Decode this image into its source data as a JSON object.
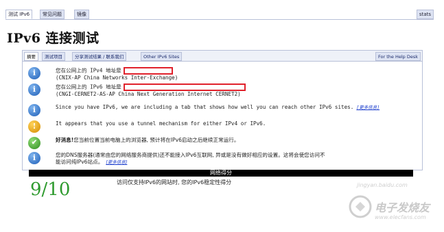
{
  "top_tabs": [
    {
      "label": "测试 IPv6",
      "active": true
    },
    {
      "label": "常见问题",
      "active": false
    },
    {
      "label": "镜像",
      "active": false
    }
  ],
  "top_right_tab": "stats",
  "page_title": "IPv6  连接测试",
  "sub_tabs": [
    {
      "label": "摘要",
      "active": true
    },
    {
      "label": "测试项目",
      "active": false
    },
    {
      "label": "分享测试结果 / 联系我们",
      "active": false
    },
    {
      "label": "Other IPv6 Sites",
      "active": false
    }
  ],
  "help_tab": "For the Help Desk",
  "rows": [
    {
      "icon": "info",
      "line1": "您在公网上的 IPv4 地址是",
      "line2": "(CNIX-AP China Networks Inter-Exchange)"
    },
    {
      "icon": "info",
      "line1": "您在公网上的 IPv6 地址是",
      "line2": "(CNGI-CERNET2-AS-AP China Next Generation Internet CERNET2)"
    },
    {
      "icon": "info",
      "line1": "Since you have IPv6, we are including a tab that shows how well you can reach other IPv6 sites.",
      "link": "[更多信息]"
    },
    {
      "icon": "warn",
      "line1": "It appears that you use a tunnel mechanism for either IPv4 or IPv6."
    },
    {
      "icon": "ok",
      "bold": "好消息!",
      "line1": "您当前位置当前电脑上的浏览器, 预计将在IPv6启动之后继续正常运行。"
    },
    {
      "icon": "info",
      "line1": "您的DNS服务器(通常由您的网络服务商提供)还不能接入IPv6互联网, 异或是没有做好相应的设置。这将会使您访问不",
      "line2": "能访问纯IPv6站点。",
      "link": "[更多信息]"
    }
  ],
  "score": {
    "header": "网络得分",
    "value": "9/10",
    "note": "访问仅支持IPv6的网站时, 您的IPv6稳定性得分"
  },
  "watermark": {
    "site": "jingyan.baidu.com",
    "cn": "电子发烧友",
    "en": "www.elecfans.com"
  }
}
